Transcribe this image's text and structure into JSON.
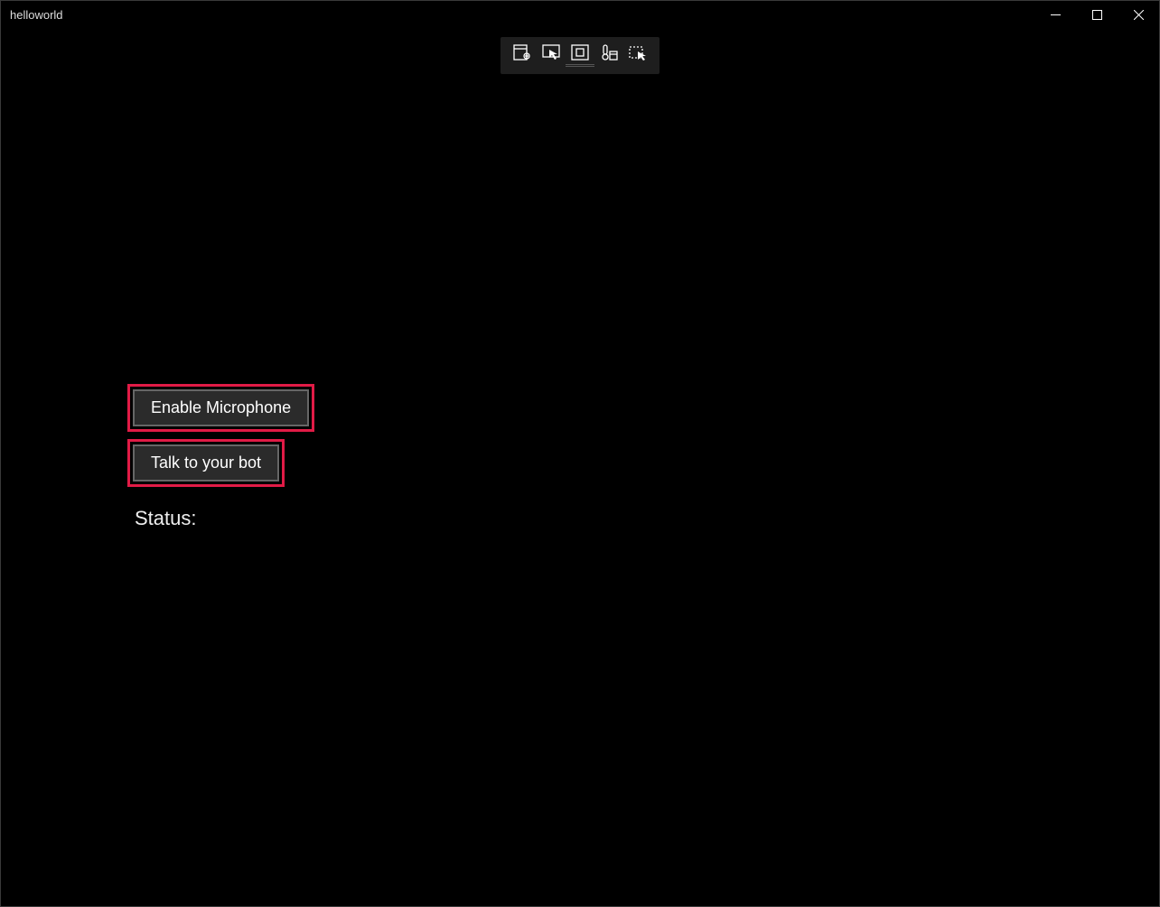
{
  "window": {
    "title": "helloworld"
  },
  "debug_toolbar": {
    "icons": [
      "design-preview-icon",
      "selection-arrow-icon",
      "layout-bounds-icon",
      "thermometer-icon",
      "screenshot-tool-icon"
    ]
  },
  "main": {
    "enable_mic_label": "Enable Microphone",
    "talk_bot_label": "Talk to your bot",
    "status_label": "Status:"
  }
}
